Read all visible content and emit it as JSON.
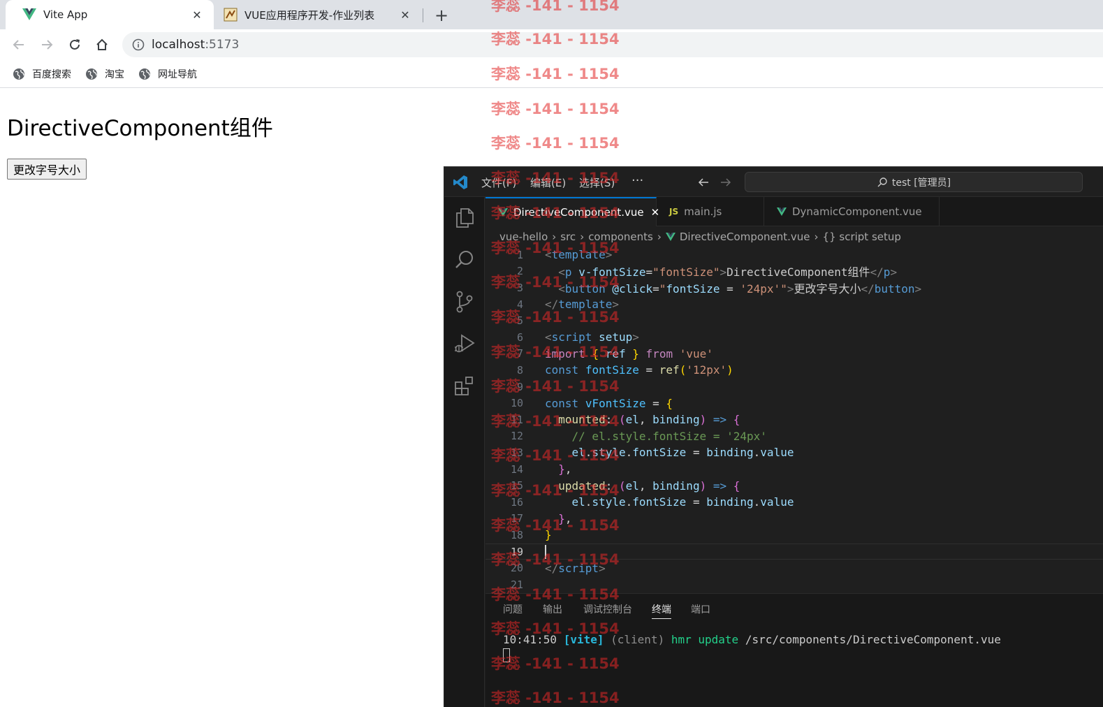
{
  "browser": {
    "tabs": [
      {
        "title": "Vite App",
        "close": "✕"
      },
      {
        "title": "VUE应用程序开发-作业列表",
        "close": "✕"
      }
    ],
    "new_tab": "+",
    "url_host": "localhost",
    "url_port": ":5173",
    "bookmarks": [
      "百度搜索",
      "淘宝",
      "网址导航"
    ]
  },
  "page": {
    "heading": "DirectiveComponent组件",
    "button_label": "更改字号大小"
  },
  "vscode": {
    "menu": [
      "文件(F)",
      "编辑(E)",
      "选择(S)"
    ],
    "more": "···",
    "search_text": "test [管理员]",
    "tabs": [
      {
        "icon": "V",
        "label": "DirectiveComponent.vue",
        "close": "✕"
      },
      {
        "icon": "JS",
        "label": "main.js"
      },
      {
        "icon": "V",
        "label": "DynamicComponent.vue"
      }
    ],
    "breadcrumbs": [
      "vue-hello",
      "src",
      "components",
      "DirectiveComponent.vue",
      "{} script setup"
    ],
    "line_numbers": [
      "1",
      "2",
      "3",
      "4",
      "5",
      "6",
      "7",
      "8",
      "9",
      "10",
      "11",
      "12",
      "13",
      "14",
      "15",
      "16",
      "17",
      "18",
      "19",
      "20",
      "21"
    ],
    "code": {
      "l1": {
        "open": "<",
        "tag": "template",
        "close": ">"
      },
      "l2": {
        "open": "<",
        "tag": "p",
        "attr": "v-fontSize",
        "eq": "=",
        "val": "\"fontSize\"",
        "gt": ">",
        "text": "DirectiveComponent组件",
        "end_open": "</",
        "end_tag": "p",
        "end_close": ">"
      },
      "l3": {
        "open": "<",
        "tag": "button",
        "attr": "@click",
        "eq": "=",
        "q1": "\"",
        "expr": "fontSize",
        "op": " = ",
        "val": "'24px'",
        "q2": "\"",
        "gt": ">",
        "text": "更改字号大小",
        "end_open": "</",
        "end_tag": "button",
        "end_close": ">"
      },
      "l4": {
        "open": "</",
        "tag": "template",
        "close": ">"
      },
      "l6": {
        "open": "<",
        "tag": "script",
        "attr": "setup",
        "close": ">"
      },
      "l7": {
        "kw": "import",
        "b1": "{",
        "id": "ref",
        "b2": "}",
        "from": "from",
        "str": "'vue'"
      },
      "l8": {
        "kw": "const",
        "var": "fontSize",
        "op": " = ",
        "fn": "ref",
        "p1": "(",
        "str": "'12px'",
        "p2": ")"
      },
      "l10": {
        "kw": "const",
        "var": "vFontSize",
        "op": " = ",
        "b": "{"
      },
      "l11": {
        "key": "mounted",
        "colon": ": ",
        "p1": "(",
        "a1": "el",
        "comma": ", ",
        "a2": "binding",
        "p2": ")",
        "arrow": " => ",
        "b": "{"
      },
      "l12": {
        "comment": "// el.style.fontSize = '24px'"
      },
      "l13": {
        "a": "el",
        "d1": ".",
        "b": "style",
        "d2": ".",
        "c": "fontSize",
        "op": " = ",
        "d": "binding",
        "d3": ".",
        "e": "value"
      },
      "l14": {
        "b": "}",
        "comma": ","
      },
      "l15": {
        "key": "updated",
        "colon": ": ",
        "p1": "(",
        "a1": "el",
        "comma": ", ",
        "a2": "binding",
        "p2": ")",
        "arrow": " => ",
        "b": "{"
      },
      "l16": {
        "a": "el",
        "d1": ".",
        "b": "style",
        "d2": ".",
        "c": "fontSize",
        "op": " = ",
        "d": "binding",
        "d3": ".",
        "e": "value"
      },
      "l17": {
        "b": "}",
        "comma": ","
      },
      "l18": {
        "b": "}"
      },
      "l20": {
        "open": "</",
        "tag": "script",
        "close": ">"
      }
    },
    "panel_tabs": [
      "问题",
      "输出",
      "调试控制台",
      "终端",
      "端口"
    ],
    "terminal": {
      "time": "10:41:50",
      "tag": "[vite]",
      "client": "(client)",
      "msg": "hmr update",
      "path": "/src/components/DirectiveComponent.vue"
    }
  },
  "watermark": "李蕊 -141 - 1154",
  "colors": {
    "accent": "#0078d4",
    "vue_green": "#42b883",
    "watermark": "#e22828"
  }
}
